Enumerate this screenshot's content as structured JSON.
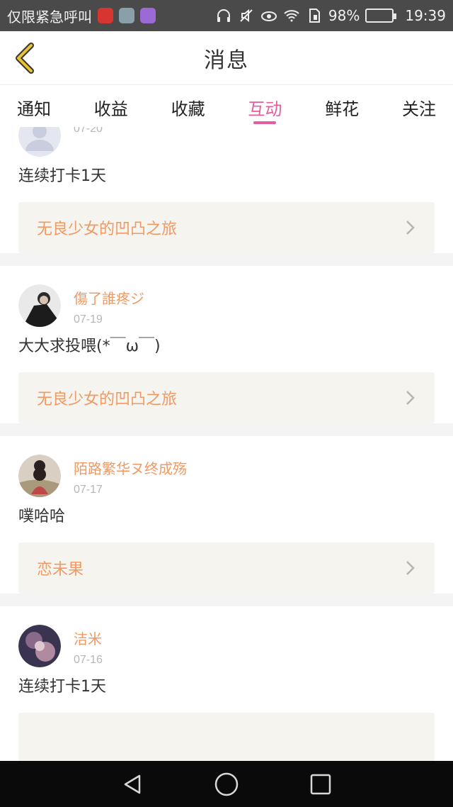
{
  "statusbar": {
    "carrier": "仅限紧急呼叫",
    "battery": "98%",
    "time": "19:39",
    "icons": [
      "netease-music-icon",
      "gallery-icon",
      "keyboard-icon",
      "headphones-icon",
      "mute-icon",
      "eye-icon",
      "wifi-icon",
      "sim-icon",
      "battery-icon"
    ]
  },
  "header": {
    "title": "消息",
    "back_icon": "chevron-left-icon"
  },
  "tabs": [
    {
      "label": "通知"
    },
    {
      "label": "收益"
    },
    {
      "label": "收藏"
    },
    {
      "label": "互动",
      "active": true
    },
    {
      "label": "鲜花"
    },
    {
      "label": "关注"
    }
  ],
  "messages": [
    {
      "user": "",
      "date": "07-20",
      "text": "连续打卡1天",
      "book": "无良少女的凹凸之旅",
      "avatar_color": "#dfe3ee"
    },
    {
      "user": "傷了誰疼ジ",
      "date": "07-19",
      "text": "大大求投喂(*￣ω￣)",
      "book": "无良少女的凹凸之旅",
      "avatar_color": "#2b2b2b"
    },
    {
      "user": "陌路繁华ヌ终成殇",
      "date": "07-17",
      "text": "噗哈哈",
      "book": "恋未果",
      "avatar_color": "#c8b8a8"
    },
    {
      "user": "洁米",
      "date": "07-16",
      "text": "连续打卡1天",
      "book": "",
      "avatar_color": "#5a4a6a"
    }
  ],
  "colors": {
    "accent": "#e55d9d",
    "name": "#ef9a64",
    "back_icon": "#e8c23a"
  }
}
